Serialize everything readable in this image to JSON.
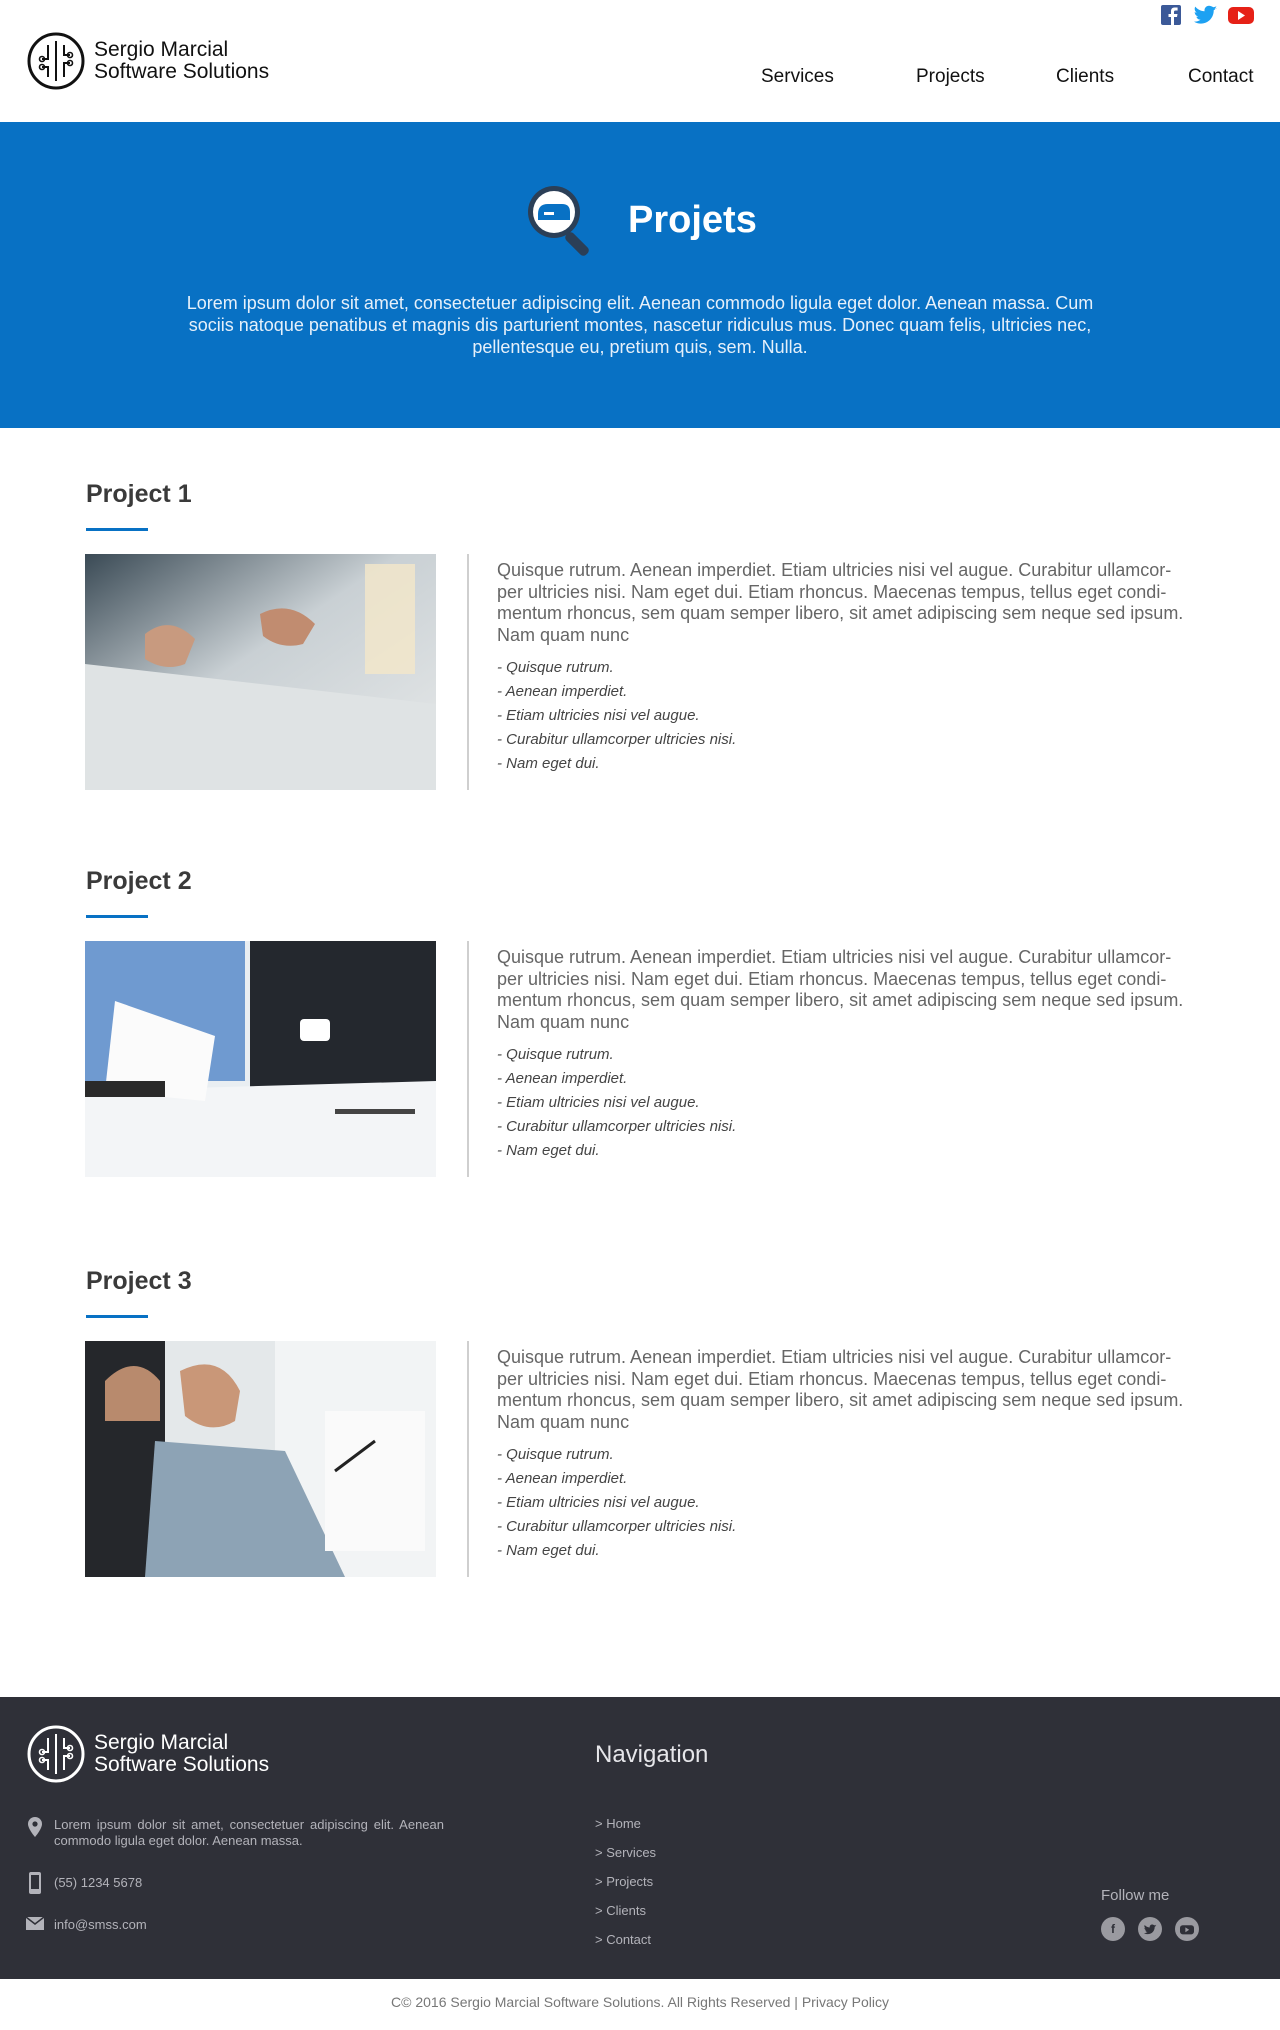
{
  "brand": {
    "name_line1": "Sergio Marcial",
    "name_line2": "Software Solutions"
  },
  "social_top": [
    "facebook-icon",
    "twitter-icon",
    "youtube-icon"
  ],
  "nav": {
    "items": [
      {
        "label": "Services"
      },
      {
        "label": "Projects"
      },
      {
        "label": "Clients"
      },
      {
        "label": "Contact"
      }
    ]
  },
  "hero": {
    "title": "Projets",
    "icon": "magnifier-icon",
    "description": "Lorem ipsum dolor sit amet, consectetuer adipiscing elit. Aenean commodo ligula eget dolor. Aenean massa. Cum sociis natoque penatibus et magnis dis parturient montes, nascetur ridiculus mus. Donec quam felis, ultricies nec, pellentesque eu, pretium quis, sem. Nulla."
  },
  "projects": [
    {
      "title": "Project 1",
      "text": "Quisque rutrum. Aenean imperdiet. Etiam ultricies nisi vel augue. Curabitur ullamcor-per ultricies nisi. Nam eget dui. Etiam rhoncus. Maecenas tempus, tellus eget condi-mentum rhoncus, sem quam semper libero, sit amet adipiscing sem neque sed ipsum. Nam quam nunc",
      "list": [
        "- Quisque rutrum.",
        "- Aenean imperdiet.",
        "- Etiam ultricies nisi vel augue.",
        "- Curabitur ullamcorper ultricies nisi.",
        "- Nam eget dui."
      ]
    },
    {
      "title": "Project 2",
      "text": "Quisque rutrum. Aenean imperdiet. Etiam ultricies nisi vel augue. Curabitur ullamcor-per ultricies nisi. Nam eget dui. Etiam rhoncus. Maecenas tempus, tellus eget condi-mentum rhoncus, sem quam semper libero, sit amet adipiscing sem neque sed ipsum. Nam quam nunc",
      "list": [
        "- Quisque rutrum.",
        "- Aenean imperdiet.",
        "- Etiam ultricies nisi vel augue.",
        "- Curabitur ullamcorper ultricies nisi.",
        "- Nam eget dui."
      ]
    },
    {
      "title": "Project 3",
      "text": "Quisque rutrum. Aenean imperdiet. Etiam ultricies nisi vel augue. Curabitur ullamcor-per ultricies nisi. Nam eget dui. Etiam rhoncus. Maecenas tempus, tellus eget condi-mentum rhoncus, sem quam semper libero, sit amet adipiscing sem neque sed ipsum. Nam quam nunc",
      "list": [
        "- Quisque rutrum.",
        "- Aenean imperdiet.",
        "- Etiam ultricies nisi vel augue.",
        "- Curabitur ullamcorper ultricies nisi.",
        "- Nam eget dui."
      ]
    }
  ],
  "footer": {
    "address": "Lorem ipsum dolor sit amet, consectetuer adipiscing elit. Aenean commodo ligula eget dolor. Aenean massa.",
    "phone": "(55) 1234 5678",
    "email": "info@smss.com",
    "nav_title": "Navigation",
    "nav_items": [
      "> Home",
      "> Services",
      "> Projects",
      "> Clients",
      "> Contact"
    ],
    "follow_label": "Follow me",
    "social": [
      "facebook-icon",
      "twitter-icon",
      "youtube-icon"
    ]
  },
  "copyright": "C© 2016 Sergio Marcial Software Solutions. All Rights Reserved | Privacy Policy",
  "colors": {
    "brand_blue": "#0871c4",
    "footer_bg": "#2f3038"
  }
}
